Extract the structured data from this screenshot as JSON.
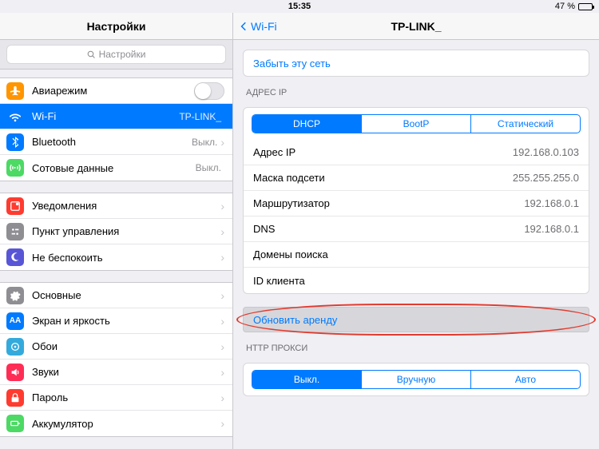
{
  "status": {
    "time": "15:35",
    "battery": "47 %"
  },
  "sidebar": {
    "title": "Настройки",
    "search_placeholder": "Настройки",
    "g1": {
      "airplane": "Авиарежим",
      "wifi": "Wi-Fi",
      "wifi_val": "TP-LINK_",
      "bt": "Bluetooth",
      "bt_val": "Выкл.",
      "cell": "Сотовые данные",
      "cell_val": "Выкл."
    },
    "g2": {
      "notif": "Уведомления",
      "cc": "Пункт управления",
      "dnd": "Не беспокоить"
    },
    "g3": {
      "gen": "Основные",
      "disp": "Экран и яркость",
      "wall": "Обои",
      "sound": "Звуки",
      "pass": "Пароль",
      "batt": "Аккумулятор"
    }
  },
  "detail": {
    "back": "Wi-Fi",
    "title": "TP-LINK_",
    "forget": "Забыть эту сеть",
    "ip_section": "АДРЕС IP",
    "seg_ip": {
      "dhcp": "DHCP",
      "bootp": "BootP",
      "static": "Статический"
    },
    "rows": {
      "ip_l": "Адрес IP",
      "ip_v": "192.168.0.103",
      "mask_l": "Маска подсети",
      "mask_v": "255.255.255.0",
      "router_l": "Маршрутизатор",
      "router_v": "192.168.0.1",
      "dns_l": "DNS",
      "dns_v": "192.168.0.1",
      "search_l": "Домены поиска",
      "search_v": "",
      "client_l": "ID клиента",
      "client_v": ""
    },
    "renew": "Обновить аренду",
    "proxy_section": "HTTP ПРОКСИ",
    "seg_proxy": {
      "off": "Выкл.",
      "manual": "Вручную",
      "auto": "Авто"
    }
  }
}
